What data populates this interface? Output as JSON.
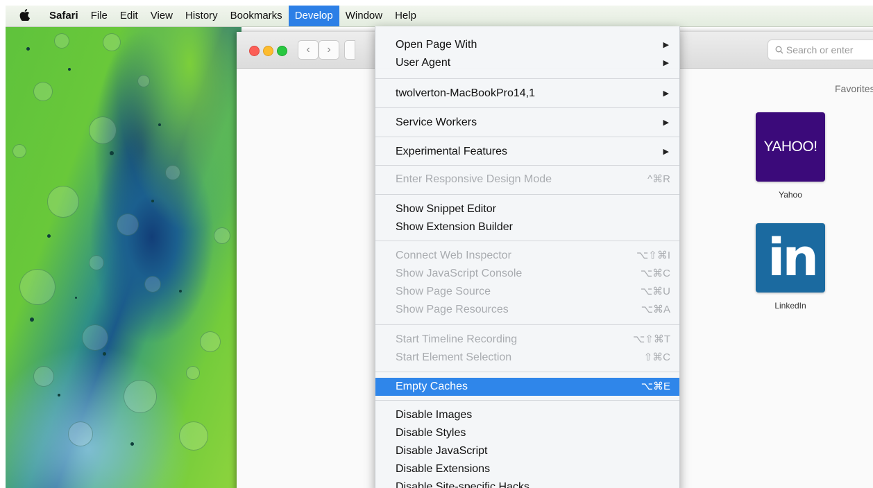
{
  "menubar": {
    "apple_icon": "apple-logo",
    "items": [
      "Safari",
      "File",
      "Edit",
      "View",
      "History",
      "Bookmarks",
      "Develop",
      "Window",
      "Help"
    ],
    "active": "Develop"
  },
  "window": {
    "search_placeholder": "Search or enter",
    "favorites_title": "Favorites",
    "favorites": [
      {
        "label": "Yahoo",
        "tile_text": "YAHOO!",
        "color": "#3b0a7a"
      },
      {
        "label": "LinkedIn",
        "tile_text": "in",
        "color": "#1b6aa0"
      }
    ]
  },
  "develop_menu": {
    "groups": [
      [
        {
          "label": "Open Page With",
          "submenu": true,
          "enabled": true
        },
        {
          "label": "User Agent",
          "submenu": true,
          "enabled": true
        }
      ],
      [
        {
          "label": "twolverton-MacBookPro14,1",
          "submenu": true,
          "enabled": true
        }
      ],
      [
        {
          "label": "Service Workers",
          "submenu": true,
          "enabled": true
        }
      ],
      [
        {
          "label": "Experimental Features",
          "submenu": true,
          "enabled": true
        }
      ],
      [
        {
          "label": "Enter Responsive Design Mode",
          "shortcut": "^⌘R",
          "enabled": false
        }
      ],
      [
        {
          "label": "Show Snippet Editor",
          "enabled": true
        },
        {
          "label": "Show Extension Builder",
          "enabled": true
        }
      ],
      [
        {
          "label": "Connect Web Inspector",
          "shortcut": "⌥⇧⌘I",
          "enabled": false
        },
        {
          "label": "Show JavaScript Console",
          "shortcut": "⌥⌘C",
          "enabled": false
        },
        {
          "label": "Show Page Source",
          "shortcut": "⌥⌘U",
          "enabled": false
        },
        {
          "label": "Show Page Resources",
          "shortcut": "⌥⌘A",
          "enabled": false
        }
      ],
      [
        {
          "label": "Start Timeline Recording",
          "shortcut": "⌥⇧⌘T",
          "enabled": false
        },
        {
          "label": "Start Element Selection",
          "shortcut": "⇧⌘C",
          "enabled": false
        }
      ],
      [
        {
          "label": "Empty Caches",
          "shortcut": "⌥⌘E",
          "enabled": true,
          "highlighted": true
        }
      ],
      [
        {
          "label": "Disable Images",
          "enabled": true
        },
        {
          "label": "Disable Styles",
          "enabled": true
        },
        {
          "label": "Disable JavaScript",
          "enabled": true
        },
        {
          "label": "Disable Extensions",
          "enabled": true
        },
        {
          "label": "Disable Site-specific Hacks",
          "enabled": true
        }
      ]
    ],
    "highlight_color": "#2f86ea"
  }
}
